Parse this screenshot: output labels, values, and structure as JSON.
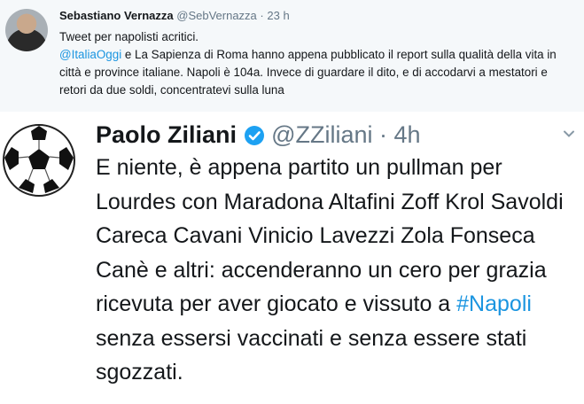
{
  "tweet1": {
    "display_name": "Sebastiano Vernazza",
    "handle": "@SebVernazza",
    "separator": "·",
    "time": "23 h",
    "line1": "Tweet per napolisti acritici.",
    "mention": "@ItaliaOggi",
    "line2_rest": " e La Sapienza di Roma hanno appena pubblicato il report sulla qualità della vita in città e province italiane. Napoli è 104a. Invece di guardare il dito, e di accodarvi a mestatori e retori da due soldi, concentratevi sulla luna"
  },
  "tweet2": {
    "display_name": "Paolo Ziliani",
    "handle": "@ZZiliani",
    "separator": "·",
    "time": "4h",
    "text_before": "E niente, è appena partito un pullman per Lourdes con Maradona Altafini Zoff Krol Savoldi Careca Cavani Vinicio Lavezzi Zola Fonseca Canè e altri: accenderanno un cero per grazia ricevuta per aver giocato e vissuto a ",
    "hashtag": "#Napoli",
    "text_after": " senza essersi vaccinati e senza essere stati sgozzati."
  },
  "icons": {
    "verified": "verified-badge-icon",
    "menu": "chevron-down-icon",
    "avatar2": "soccer-ball-avatar"
  },
  "colors": {
    "link": "#1b95e0",
    "text": "#14171a",
    "muted": "#657786",
    "top_bg": "#f5f8fa"
  }
}
